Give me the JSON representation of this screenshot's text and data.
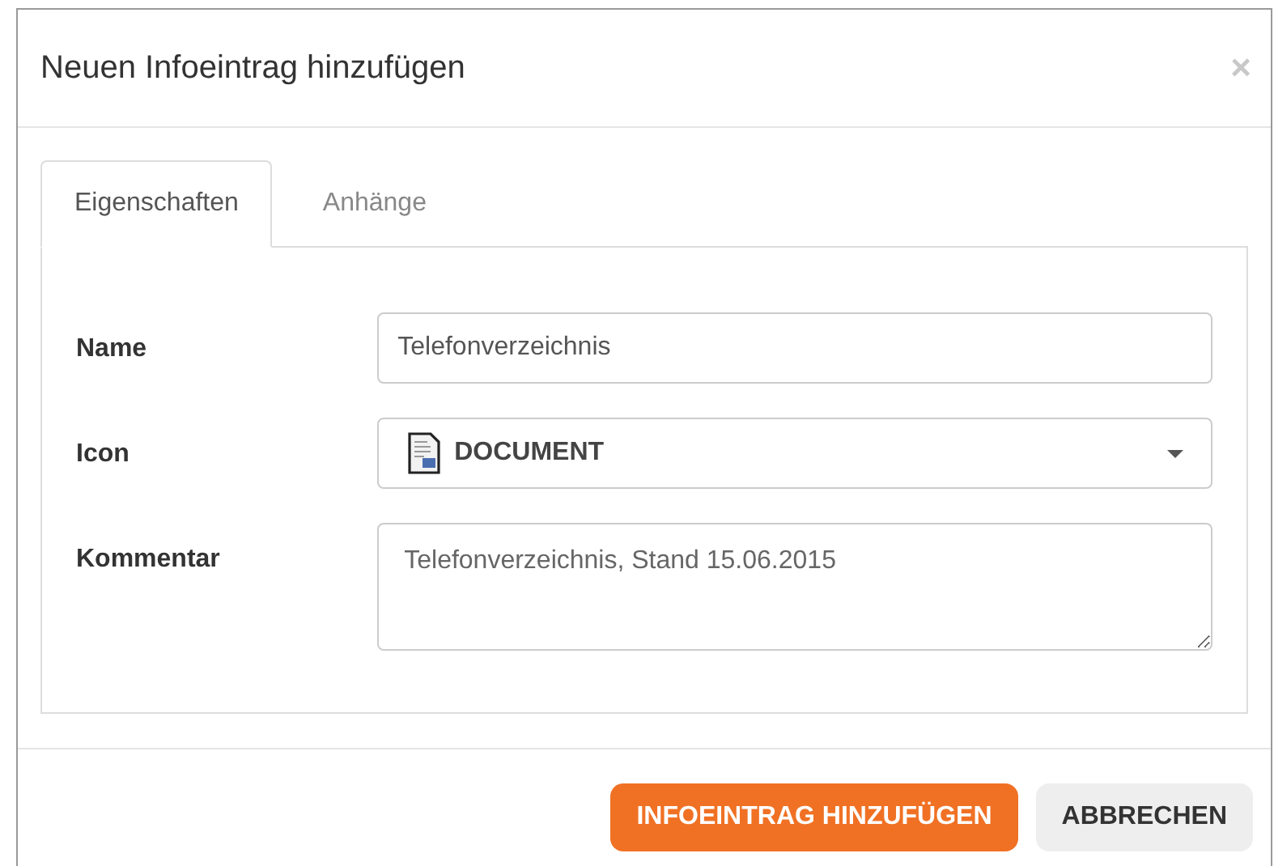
{
  "dialog": {
    "title": "Neuen Infoeintrag hinzufügen",
    "close": "×"
  },
  "tabs": [
    {
      "label": "Eigenschaften",
      "selected": true
    },
    {
      "label": "Anhänge",
      "selected": false
    }
  ],
  "fields": [
    {
      "kind": "text",
      "label": "Name",
      "value": "Telefonverzeichnis"
    },
    {
      "kind": "select",
      "label": "Icon",
      "value": "DOCUMENT"
    },
    {
      "kind": "textarea",
      "label": "Kommentar",
      "value": "Telefonverzeichnis, Stand 15.06.2015"
    }
  ],
  "buttons": [
    {
      "label": "INFOEINTRAG HINZUFÜGEN",
      "kind": "primary"
    },
    {
      "label": "ABBRECHEN",
      "kind": "secondary"
    }
  ]
}
